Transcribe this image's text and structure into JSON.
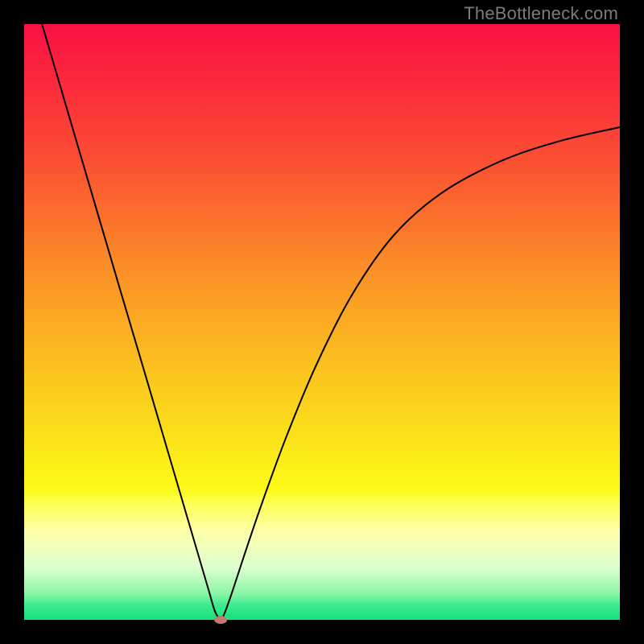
{
  "watermark": "TheBottleneck.com",
  "chart_data": {
    "type": "line",
    "title": "",
    "xlabel": "",
    "ylabel": "",
    "xlim": [
      0,
      100
    ],
    "ylim": [
      0,
      100
    ],
    "grid": false,
    "legend": false,
    "background": {
      "type": "vertical-gradient",
      "stops": [
        {
          "pos": 0.0,
          "color": "#fa1043"
        },
        {
          "pos": 0.12,
          "color": "#fb2f3a"
        },
        {
          "pos": 0.25,
          "color": "#fb5631"
        },
        {
          "pos": 0.4,
          "color": "#fb8b28"
        },
        {
          "pos": 0.55,
          "color": "#fbba20"
        },
        {
          "pos": 0.7,
          "color": "#fbe31a"
        },
        {
          "pos": 0.78,
          "color": "#fcfa16"
        },
        {
          "pos": 0.8,
          "color": "#fdff4a"
        },
        {
          "pos": 0.85,
          "color": "#feffa8"
        },
        {
          "pos": 0.91,
          "color": "#e0ffd0"
        },
        {
          "pos": 0.955,
          "color": "#8cf7a6"
        },
        {
          "pos": 0.975,
          "color": "#3deb8e"
        },
        {
          "pos": 1.0,
          "color": "#17e07e"
        }
      ]
    },
    "series": [
      {
        "name": "bottleneck-curve",
        "color": "#000000",
        "stroke_width": 2,
        "x": [
          3.0,
          5.0,
          8.0,
          12.0,
          16.0,
          20.0,
          24.0,
          27.0,
          29.5,
          31.0,
          32.0,
          32.8,
          33.2,
          33.8,
          35.0,
          37.0,
          40.0,
          44.0,
          49.0,
          55.0,
          62.0,
          70.0,
          80.0,
          90.0,
          100.0
        ],
        "y": [
          100.0,
          93.2,
          83.0,
          69.4,
          55.8,
          42.3,
          28.7,
          18.5,
          10.0,
          4.9,
          1.5,
          0.2,
          0.2,
          1.5,
          4.9,
          11.0,
          19.8,
          30.7,
          42.7,
          54.5,
          64.5,
          71.6,
          77.0,
          80.4,
          82.7
        ]
      }
    ],
    "marker": {
      "name": "min-point",
      "x": 33.0,
      "y": 0.0,
      "color": "#c47a72",
      "rx": 8,
      "ry": 5
    }
  }
}
